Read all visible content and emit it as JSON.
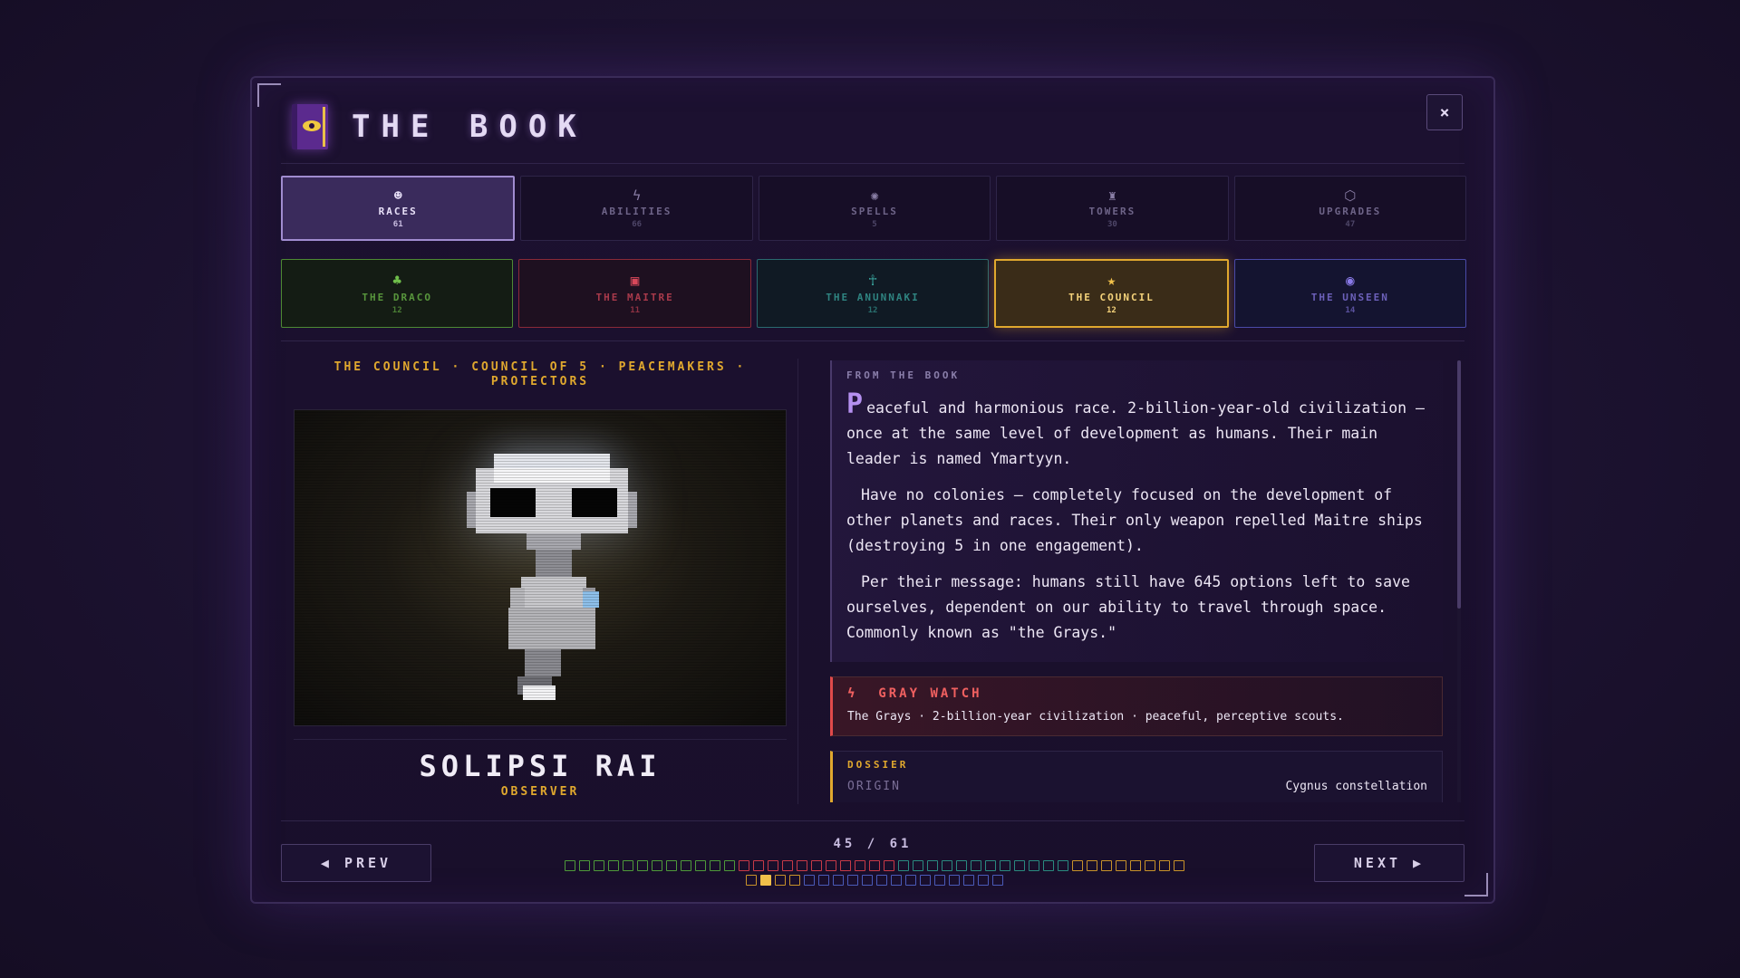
{
  "header": {
    "title": "THE BOOK",
    "close_label": "×"
  },
  "tabs": [
    {
      "label": "RACES",
      "count": "61",
      "icon": "☻",
      "icon_name": "alien-head-icon",
      "active": true
    },
    {
      "label": "ABILITIES",
      "count": "66",
      "icon": "ϟ",
      "icon_name": "lightning-icon",
      "active": false
    },
    {
      "label": "SPELLS",
      "count": "5",
      "icon": "✺",
      "icon_name": "spiral-icon",
      "active": false
    },
    {
      "label": "TOWERS",
      "count": "30",
      "icon": "♜",
      "icon_name": "tower-icon",
      "active": false
    },
    {
      "label": "UPGRADES",
      "count": "47",
      "icon": "⬡",
      "icon_name": "gem-icon",
      "active": false
    }
  ],
  "factions": [
    {
      "label": "THE DRACO",
      "count": "12",
      "icon": "♣",
      "icon_name": "draco-icon",
      "color": "#6fbf4a",
      "border": "#4e8a34",
      "bg": "#141c14",
      "active": false
    },
    {
      "label": "THE MAITRE",
      "count": "11",
      "icon": "▣",
      "icon_name": "maitre-icon",
      "color": "#d8485a",
      "border": "#8a2a38",
      "bg": "#1e1020",
      "active": false
    },
    {
      "label": "THE ANUNNAKI",
      "count": "12",
      "icon": "☥",
      "icon_name": "ankh-icon",
      "color": "#3aa8a0",
      "border": "#2a6a70",
      "bg": "#101a24",
      "active": false
    },
    {
      "label": "THE COUNCIL",
      "count": "12",
      "icon": "★",
      "icon_name": "council-star-icon",
      "color": "#f0c04a",
      "border": "#e0a82e",
      "bg": "#3a2c18",
      "active": true
    },
    {
      "label": "THE UNSEEN",
      "count": "14",
      "icon": "◉",
      "icon_name": "unseen-eye-icon",
      "color": "#8a7ae8",
      "border": "#4a4aa8",
      "bg": "#141430",
      "active": false
    }
  ],
  "character": {
    "subtitle": "THE COUNCIL · COUNCIL OF 5 · PEACEMAKERS · PROTECTORS",
    "name": "SOLIPSI RAI",
    "role": "OBSERVER"
  },
  "lore": {
    "heading": "FROM THE BOOK",
    "dropcap": "P",
    "paragraph1": "eaceful and harmonious race. 2-billion-year-old civilization – once at the same level of development as humans. Their main leader is named Ymartyyn.",
    "paragraph2": "Have no colonies – completely focused on the development of other planets and races. Their only weapon repelled Maitre ships (destroying 5 in one engagement).",
    "paragraph3": "Per their message: humans still have 645 options left to save ourselves, dependent on our ability to travel through space. Commonly known as \"the Grays.\""
  },
  "ability": {
    "icon": "ϟ",
    "name": "GRAY WATCH",
    "description": "The Grays · 2-billion-year civilization · peaceful, perceptive scouts."
  },
  "dossier": {
    "heading": "DOSSIER",
    "rows": [
      {
        "key": "ORIGIN",
        "value": "Cygnus constellation"
      }
    ]
  },
  "pagination": {
    "prev_label": "◀ PREV",
    "next_label": "NEXT ▶",
    "counter": "45 / 61",
    "current": 45,
    "total": 61,
    "groups": [
      {
        "faction": "THE DRACO",
        "count": 12,
        "color": "#4e9a3a"
      },
      {
        "faction": "THE MAITRE",
        "count": 11,
        "color": "#c83a48"
      },
      {
        "faction": "THE ANUNNAKI",
        "count": 12,
        "color": "#2a8a80"
      },
      {
        "faction": "THE COUNCIL",
        "count": 12,
        "color": "#c8922a"
      },
      {
        "faction": "THE UNSEEN",
        "count": 14,
        "color": "#4a5ab8"
      }
    ]
  }
}
